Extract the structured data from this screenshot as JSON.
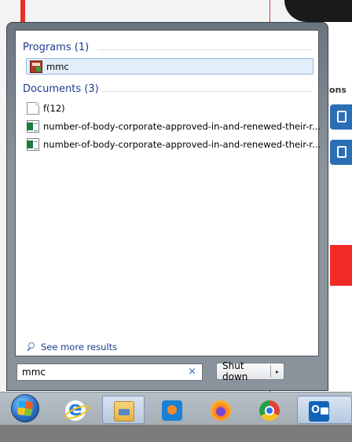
{
  "start_menu": {
    "programs": {
      "header": "Programs (1)",
      "items": [
        {
          "label": "mmc"
        }
      ]
    },
    "documents": {
      "header": "Documents (3)",
      "items": [
        {
          "label": "f(12)"
        },
        {
          "label": "number-of-body-corporate-approved-in-and-renewed-their-r..."
        },
        {
          "label": "number-of-body-corporate-approved-in-and-renewed-their-r..."
        }
      ]
    },
    "see_more": "See more results",
    "search": {
      "value": "mmc",
      "clear": "×"
    },
    "shutdown": {
      "label": "Shut down",
      "arrow": "▸"
    }
  },
  "background_app": {
    "partial_text": "ons"
  },
  "taskbar": {
    "buttons": [
      "start-orb",
      "internet-explorer",
      "file-explorer",
      "media-player",
      "firefox",
      "chrome",
      "outlook"
    ],
    "active": "file-explorer"
  }
}
